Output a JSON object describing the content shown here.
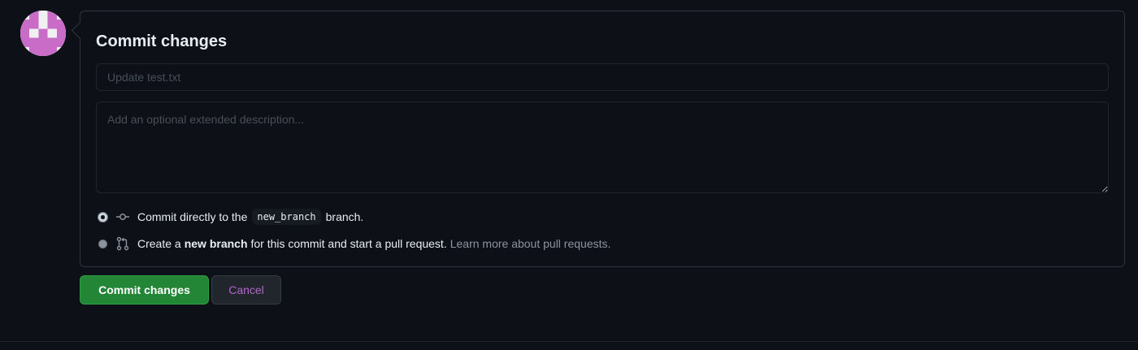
{
  "avatar": {
    "icon": "identicon",
    "color": "#c86cc8"
  },
  "commit_panel": {
    "title": "Commit changes",
    "summary_placeholder": "Update test.txt",
    "summary_value": "",
    "description_placeholder": "Add an optional extended description...",
    "description_value": "",
    "options": [
      {
        "checked": true,
        "icon": "git-commit-icon",
        "text_before": "Commit directly to the",
        "branch": "new_branch",
        "text_after": "branch."
      },
      {
        "checked": false,
        "icon": "git-pull-request-icon",
        "text_before": "Create a",
        "bold": "new branch",
        "text_after": "for this commit and start a pull request.",
        "link": "Learn more about pull requests."
      }
    ]
  },
  "actions": {
    "commit_label": "Commit changes",
    "cancel_label": "Cancel"
  },
  "colors": {
    "background": "#0d1117",
    "border": "#30363d",
    "primary": "#238636",
    "cancel_text": "#b166c9",
    "link": "#8b949e"
  }
}
